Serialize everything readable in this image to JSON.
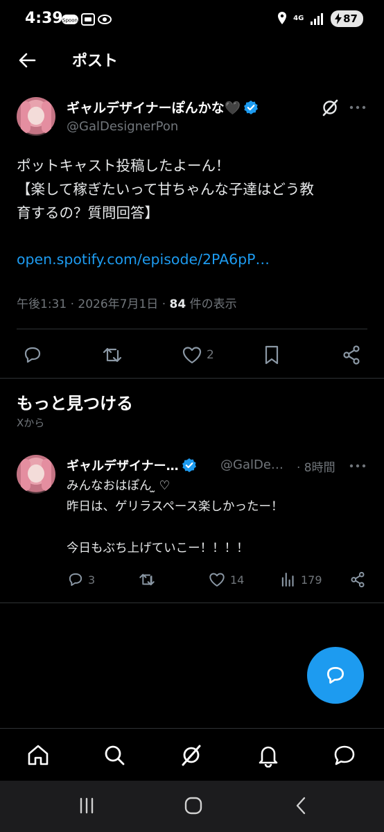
{
  "status_bar": {
    "time": "4:39",
    "network": "4G",
    "battery": "87"
  },
  "header": {
    "title": "ポスト"
  },
  "post": {
    "display_name": "ギャルデザイナーぽんかな🖤",
    "handle": "@GalDesignerPon",
    "lines": [
      "ポットキャスト投稿したよーん！",
      "【楽して稼ぎたいって甘ちゃんな子達はどう教",
      "育するの？質問回答】"
    ],
    "link": "open.spotify.com/episode/2PA6pP…",
    "time": "午後1:31",
    "date": "2026年7月1日",
    "views": "84",
    "views_label": "件の表示",
    "likes": "2"
  },
  "discover": {
    "title": "もっと見つける",
    "subtitle": "Xから"
  },
  "suggested_post": {
    "display_name": "ギャルデザイナー…",
    "handle": "@GalDe…",
    "time": "· 8時間",
    "lines": [
      "みんなおはぽん ̫ ♡",
      "昨日は、ゲリラスペース楽しかったー！",
      "",
      "今日もぶち上げていこー！！！！"
    ],
    "replies": "3",
    "likes": "14",
    "views": "179"
  },
  "colors": {
    "background": "#000000",
    "accent": "#1d9bf0",
    "secondary_text": "#71767b",
    "divider": "#2f3336"
  },
  "icons": [
    "back-arrow-icon",
    "verified-badge-icon",
    "grok-icon",
    "more-icon",
    "reply-icon",
    "repost-icon",
    "like-icon",
    "bookmark-icon",
    "share-icon",
    "views-icon",
    "compose-icon",
    "home-icon",
    "search-icon",
    "notifications-icon",
    "messages-icon"
  ]
}
